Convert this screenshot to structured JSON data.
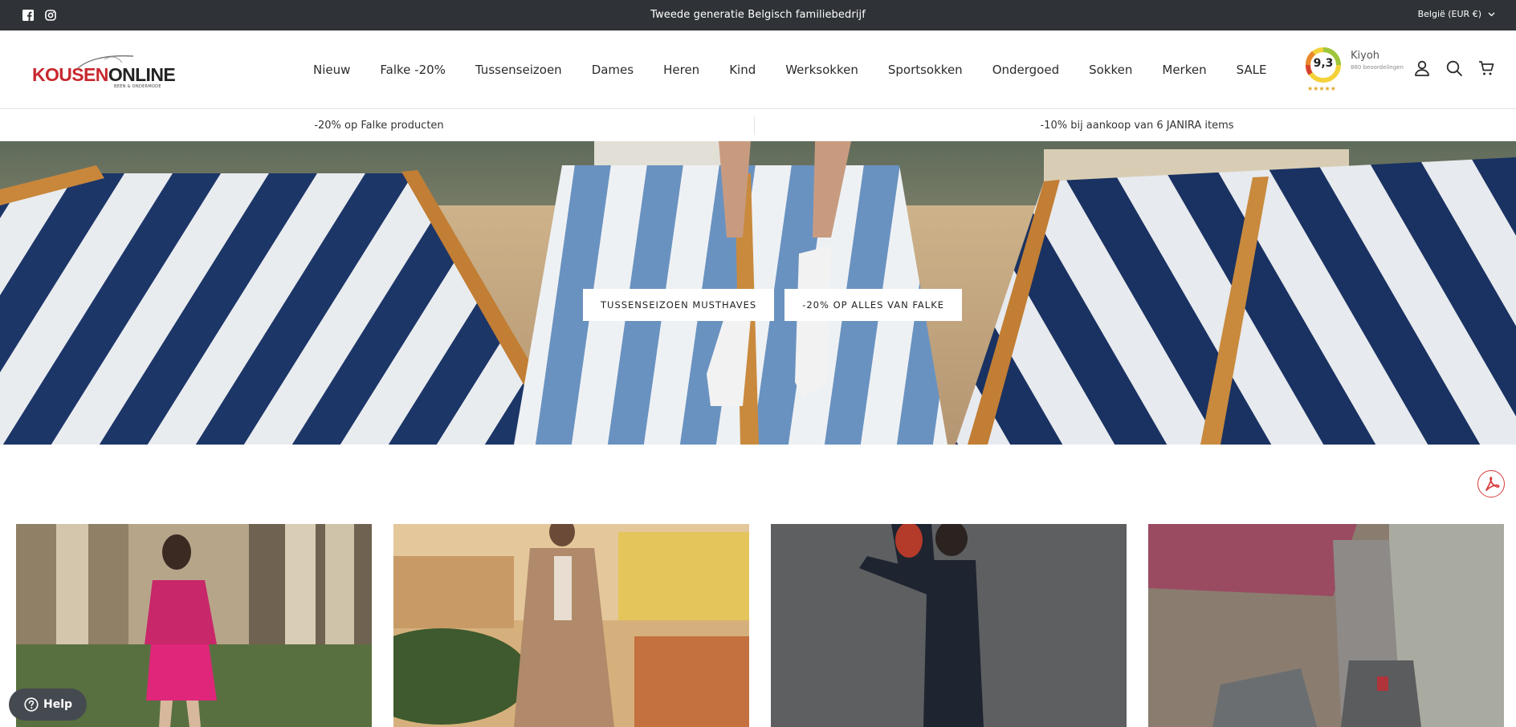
{
  "topbar": {
    "announcement": "Tweede generatie Belgisch familiebedrijf",
    "locale": "België (EUR €)",
    "social": [
      "facebook-icon",
      "instagram-icon"
    ]
  },
  "logo": {
    "word_red": "KOUSEN",
    "word_dark": "ONLINE",
    "tagline": "BEEN & ONDERMODE"
  },
  "nav": {
    "items": [
      "Nieuw",
      "Falke -20%",
      "Tussenseizoen",
      "Dames",
      "Heren",
      "Kind",
      "Werksokken",
      "Sportsokken",
      "Ondergoed",
      "Sokken",
      "Merken",
      "SALE"
    ]
  },
  "kiyoh": {
    "score": "9,3",
    "brand": "Kiyoh",
    "reviews": "860 beoordelingen",
    "stars": "★★★★★"
  },
  "header_icons": [
    "account-icon",
    "search-icon",
    "cart-icon"
  ],
  "promo": {
    "left": "-20% op Falke producten",
    "right": "-10% bij aankoop van 6 JANIRA items"
  },
  "hero": {
    "buttons": [
      "TUSSENSEIZOEN MUSTHAVES",
      "-20% OP ALLES VAN FALKE"
    ]
  },
  "help": {
    "label": "Help"
  },
  "colors": {
    "topbar": "#2f3337",
    "brand_red": "#c8282e",
    "navy_stripe": "#1c3566",
    "sky_stripe": "#6c93bf",
    "pdf_red": "#d83a3a"
  }
}
